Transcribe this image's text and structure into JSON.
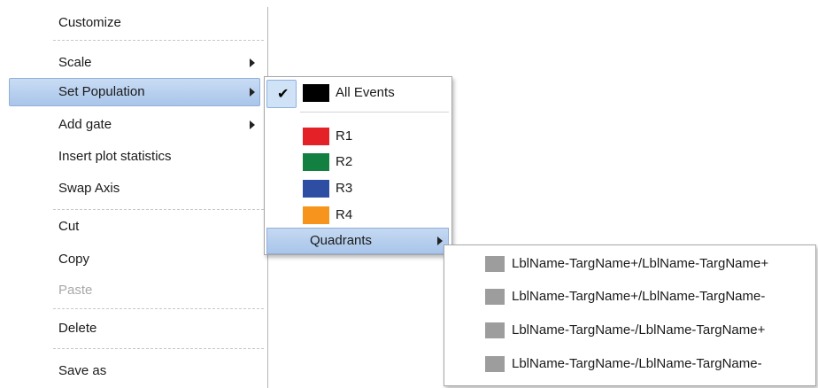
{
  "context_menu": {
    "items": [
      {
        "label": "Customize"
      },
      {
        "label": "Scale"
      },
      {
        "label": "Set Population"
      },
      {
        "label": "Add gate"
      },
      {
        "label": "Insert plot statistics"
      },
      {
        "label": "Swap Axis"
      },
      {
        "label": "Cut"
      },
      {
        "label": "Copy"
      },
      {
        "label": "Paste"
      },
      {
        "label": "Delete"
      },
      {
        "label": "Save as"
      }
    ],
    "highlighted": "Set Population",
    "disabled": [
      "Paste"
    ]
  },
  "population_menu": {
    "items": [
      {
        "label": "All Events",
        "color": "#000000",
        "checked": true
      },
      {
        "label": "R1",
        "color": "#e32126"
      },
      {
        "label": "R2",
        "color": "#118040"
      },
      {
        "label": "R3",
        "color": "#2e4ea3"
      },
      {
        "label": "R4",
        "color": "#f7941d"
      },
      {
        "label": "Quadrants"
      }
    ]
  },
  "quadrants_menu": {
    "items": [
      {
        "label": "LblName-TargName+/LblName-TargName+",
        "color": "#9d9d9d"
      },
      {
        "label": "LblName-TargName+/LblName-TargName-",
        "color": "#9d9d9d"
      },
      {
        "label": "LblName-TargName-/LblName-TargName+",
        "color": "#9d9d9d"
      },
      {
        "label": "LblName-TargName-/LblName-TargName-",
        "color": "#9d9d9d"
      }
    ]
  }
}
